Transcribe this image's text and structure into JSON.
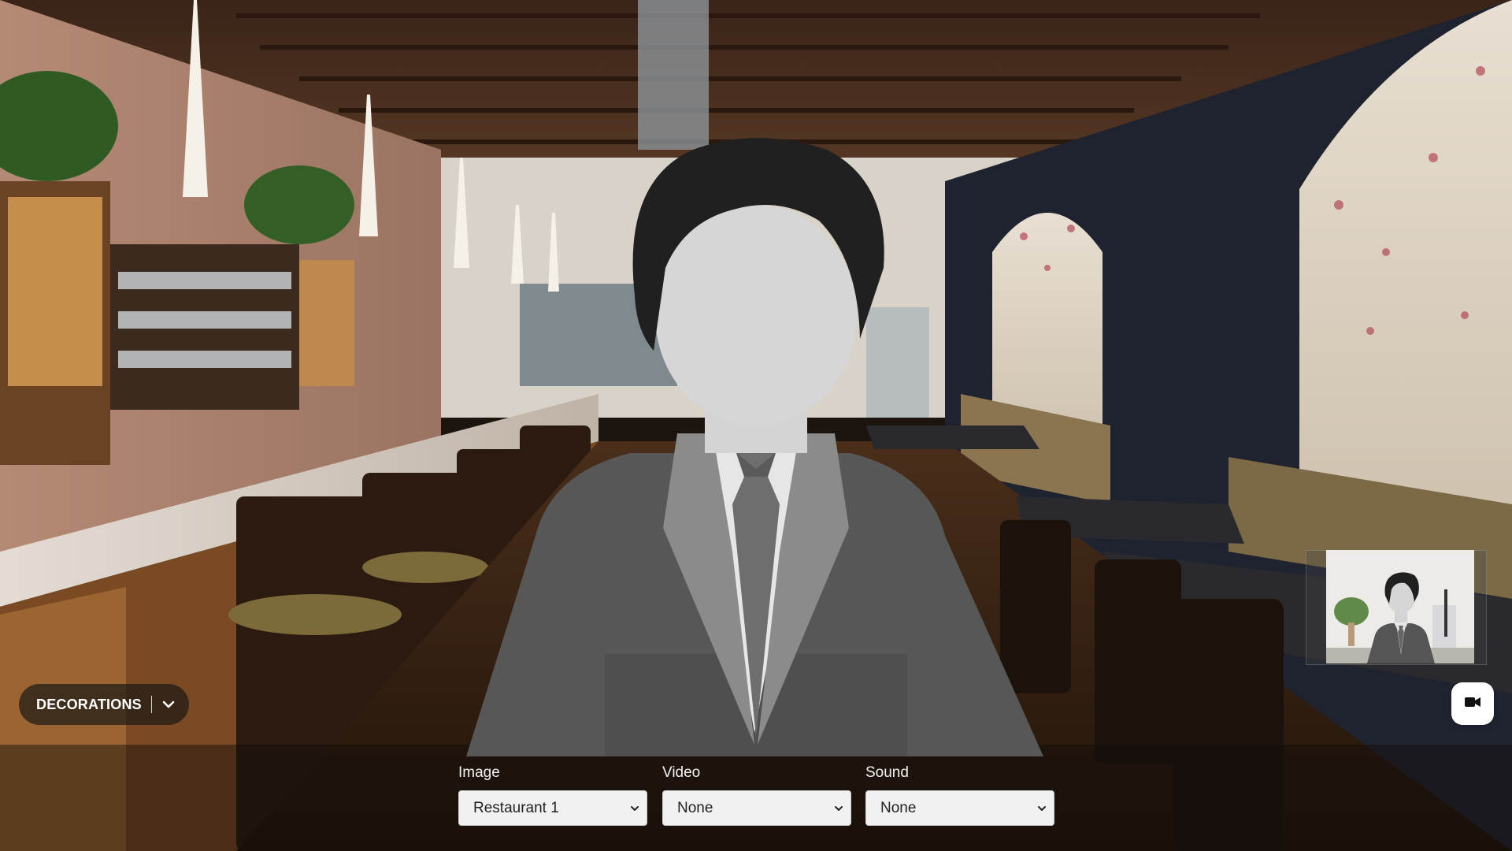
{
  "decorations": {
    "label": "DECORATIONS",
    "chevron_icon": "chevron-down-icon"
  },
  "selectors": {
    "image": {
      "label": "Image",
      "value": "Restaurant 1"
    },
    "video": {
      "label": "Video",
      "value": "None"
    },
    "sound": {
      "label": "Sound",
      "value": "None"
    }
  },
  "camera_button": {
    "icon": "video-camera-icon"
  },
  "background": {
    "scene": "restaurant-interior"
  }
}
